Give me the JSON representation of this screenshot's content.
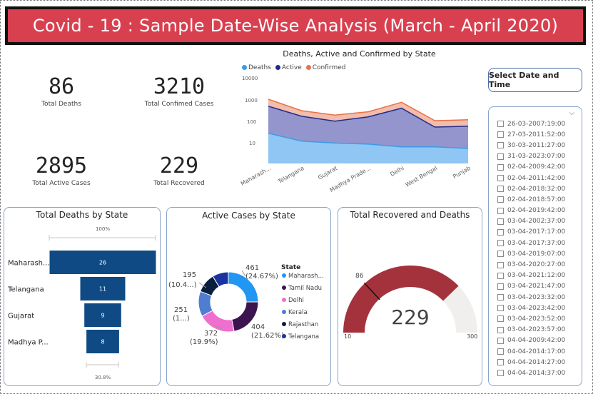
{
  "header": {
    "title": "Covid - 19 : Sample Date-Wise Analysis (March - April 2020)"
  },
  "kpis": [
    {
      "value": "86",
      "label": "Total Deaths"
    },
    {
      "value": "3210",
      "label": "Total Confimed Cases"
    },
    {
      "value": "2895",
      "label": "Total Active Cases"
    },
    {
      "value": "229",
      "label": "Total Recovered"
    }
  ],
  "area_chart": {
    "title": "Deaths, Active and Confirmed by State",
    "legend": [
      {
        "name": "Deaths",
        "color": "#3c9be8"
      },
      {
        "name": "Active",
        "color": "#1f2d8c"
      },
      {
        "name": "Confirmed",
        "color": "#e8734a"
      }
    ],
    "y_ticks": [
      "10000",
      "1000",
      "100",
      "10"
    ],
    "states": [
      "Maharash...",
      "Telangana",
      "Gujarat",
      "Madhya Prade...",
      "Delhi",
      "West Bengal",
      "Punjab"
    ]
  },
  "funnel": {
    "title": "Total Deaths by State",
    "top_label": "100%",
    "bottom_label": "30.8%",
    "color": "#0f4a84"
  },
  "donut": {
    "title": "Active Cases by State",
    "legend_title": "State",
    "labels": {
      "l461": "461",
      "l461p": "(24.67%)",
      "l404": "404",
      "l404p": "(21.62%)",
      "l372": "372",
      "l372p": "(19.9%)",
      "l251": "251",
      "l251p": "(1...)",
      "l195": "195",
      "l195p": "(10.4...)"
    }
  },
  "gauge": {
    "title": "Total Recovered and Deaths",
    "min_label": "10",
    "max_label": "300",
    "target_label": "86",
    "value_label": "229",
    "fill_color": "#a4323d",
    "track_color": "#f0efee"
  },
  "slicer": {
    "button_label": "Select Date and Time",
    "items": [
      "26-03-2007:19:00",
      "27-03-2011:52:00",
      "30-03-2011:27:00",
      "31-03-2023:07:00",
      "02-04-2009:42:00",
      "02-04-2011:42:00",
      "02-04-2018:32:00",
      "02-04-2018:57:00",
      "02-04-2019:42:00",
      "03-04-2002:37:00",
      "03-04-2017:17:00",
      "03-04-2017:37:00",
      "03-04-2019:07:00",
      "03-04-2020:27:00",
      "03-04-2021:12:00",
      "03-04-2021:47:00",
      "03-04-2023:32:00",
      "03-04-2023:42:00",
      "03-04-2023:52:00",
      "03-04-2023:57:00",
      "04-04-2009:42:00",
      "04-04-2014:17:00",
      "04-04-2014:27:00",
      "04-04-2014:37:00"
    ]
  },
  "chart_data": [
    {
      "type": "area",
      "title": "Deaths, Active and Confirmed by State",
      "categories": [
        "Maharash...",
        "Telangana",
        "Gujarat",
        "Madhya Prade...",
        "Delhi",
        "West Bengal",
        "Punjab"
      ],
      "yscale": "log",
      "ylim": [
        1,
        10000
      ],
      "series": [
        {
          "name": "Deaths",
          "values": [
            26,
            11,
            9,
            8,
            6,
            6,
            5
          ]
        },
        {
          "name": "Active",
          "values": [
            470,
            160,
            95,
            150,
            380,
            50,
            55
          ]
        },
        {
          "name": "Confirmed",
          "values": [
            1000,
            290,
            180,
            260,
            720,
            100,
            110
          ]
        }
      ]
    },
    {
      "type": "funnel",
      "title": "Total Deaths by State",
      "categories": [
        "Maharash...",
        "Telangana",
        "Gujarat",
        "Madhya P..."
      ],
      "values": [
        26,
        11,
        9,
        8
      ]
    },
    {
      "type": "pie",
      "title": "Active Cases by State",
      "legend_position": "right",
      "categories": [
        "Maharash...",
        "Tamil Nadu",
        "Delhi",
        "Kerala",
        "Rajasthan",
        "Telangana"
      ],
      "values": [
        461,
        404,
        372,
        251,
        195,
        160
      ],
      "colors": [
        "#2196f3",
        "#3d1450",
        "#ef6fcf",
        "#4f7dd1",
        "#0a1f3d",
        "#1b32a0"
      ]
    },
    {
      "type": "gauge",
      "title": "Total Recovered and Deaths",
      "value": 229,
      "min": 10,
      "max": 300,
      "target": 86
    }
  ]
}
